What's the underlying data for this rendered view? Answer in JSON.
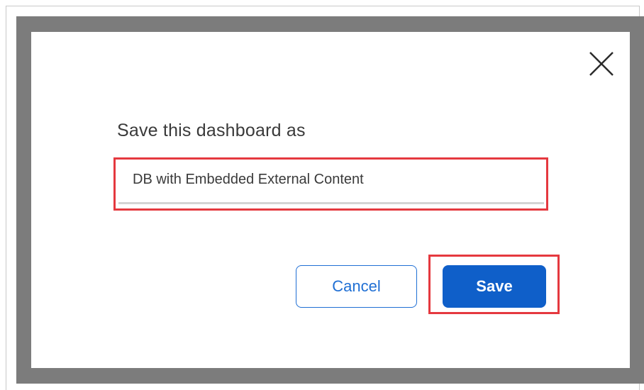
{
  "dialog": {
    "heading": "Save this dashboard as",
    "name_input": {
      "value": "DB with Embedded External Content",
      "placeholder": ""
    },
    "close_icon": "close-icon",
    "buttons": {
      "cancel_label": "Cancel",
      "save_label": "Save"
    }
  },
  "colors": {
    "overlay": "#7c7c7c",
    "dialog_background": "#ffffff",
    "primary": "#0f5fc9",
    "secondary_text": "#1f6fd4",
    "highlight": "#e5393f",
    "heading_text": "#3a3a3a"
  }
}
